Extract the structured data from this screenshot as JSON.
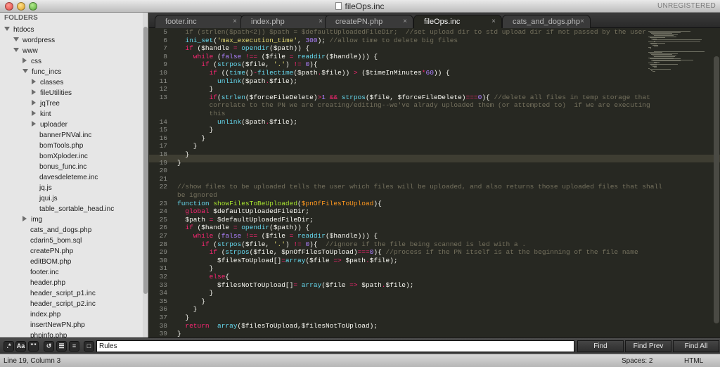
{
  "window": {
    "title": "fileOps.inc",
    "registration": "UNREGISTERED"
  },
  "sidebar": {
    "header": "FOLDERS",
    "items": [
      {
        "label": "htdocs",
        "depth": 0,
        "kind": "folder-open"
      },
      {
        "label": "wordpress",
        "depth": 1,
        "kind": "folder-open"
      },
      {
        "label": "www",
        "depth": 1,
        "kind": "folder-open"
      },
      {
        "label": "css",
        "depth": 2,
        "kind": "folder-closed"
      },
      {
        "label": "func_incs",
        "depth": 2,
        "kind": "folder-open"
      },
      {
        "label": "classes",
        "depth": 3,
        "kind": "folder-closed"
      },
      {
        "label": "fileUtilities",
        "depth": 3,
        "kind": "folder-closed"
      },
      {
        "label": "jqTree",
        "depth": 3,
        "kind": "folder-closed"
      },
      {
        "label": "kint",
        "depth": 3,
        "kind": "folder-closed"
      },
      {
        "label": "uploader",
        "depth": 3,
        "kind": "folder-closed"
      },
      {
        "label": "bannerPNVal.inc",
        "depth": 3,
        "kind": "file"
      },
      {
        "label": "bomTools.php",
        "depth": 3,
        "kind": "file"
      },
      {
        "label": "bomXploder.inc",
        "depth": 3,
        "kind": "file"
      },
      {
        "label": "bonus_func.inc",
        "depth": 3,
        "kind": "file"
      },
      {
        "label": "davesdeleteme.inc",
        "depth": 3,
        "kind": "file"
      },
      {
        "label": "jq.js",
        "depth": 3,
        "kind": "file"
      },
      {
        "label": "jqui.js",
        "depth": 3,
        "kind": "file"
      },
      {
        "label": "table_sortable_head.inc",
        "depth": 3,
        "kind": "file"
      },
      {
        "label": "img",
        "depth": 2,
        "kind": "folder-closed"
      },
      {
        "label": "cats_and_dogs.php",
        "depth": 2,
        "kind": "file"
      },
      {
        "label": "cdarin5_bom.sql",
        "depth": 2,
        "kind": "file"
      },
      {
        "label": "createPN.php",
        "depth": 2,
        "kind": "file"
      },
      {
        "label": "editBOM.php",
        "depth": 2,
        "kind": "file"
      },
      {
        "label": "footer.inc",
        "depth": 2,
        "kind": "file"
      },
      {
        "label": "header.php",
        "depth": 2,
        "kind": "file"
      },
      {
        "label": "header_script_p1.inc",
        "depth": 2,
        "kind": "file"
      },
      {
        "label": "header_script_p2.inc",
        "depth": 2,
        "kind": "file"
      },
      {
        "label": "index.php",
        "depth": 2,
        "kind": "file"
      },
      {
        "label": "insertNewPN.php",
        "depth": 2,
        "kind": "file"
      },
      {
        "label": "phpinfo.php",
        "depth": 2,
        "kind": "file"
      }
    ]
  },
  "tabs": [
    {
      "label": "footer.inc",
      "close": "×",
      "active": false
    },
    {
      "label": "index.php",
      "close": "×",
      "active": false
    },
    {
      "label": "createPN.php",
      "close": "×",
      "active": false
    },
    {
      "label": "fileOps.inc",
      "close": "×",
      "active": true
    },
    {
      "label": "cats_and_dogs.php",
      "close": "×",
      "active": false
    }
  ],
  "editor": {
    "line_numbers": [
      "5",
      "6",
      "7",
      "8",
      "9",
      "10",
      "11",
      "12",
      "13",
      "",
      "",
      "14",
      "15",
      "16",
      "17",
      "18",
      "19",
      "20",
      "21",
      "22",
      "",
      "23",
      "24",
      "25",
      "26",
      "27",
      "28",
      "29",
      "30",
      "31",
      "32",
      "33",
      "34",
      "35",
      "36",
      "37",
      "38",
      "39",
      "40"
    ],
    "code_lines": [
      {
        "indent": 2,
        "spans": [
          {
            "t": "if (strlen($path<2)) $path = $defaultUploadedFileDir;  //set upload dir to std upload dir if not passed by the user",
            "c": "c"
          }
        ]
      },
      {
        "indent": 2,
        "spans": [
          {
            "t": "ini_set",
            "c": "f"
          },
          {
            "t": "(",
            "c": ""
          },
          {
            "t": "'max_execution_time'",
            "c": "s"
          },
          {
            "t": ", ",
            "c": ""
          },
          {
            "t": "300",
            "c": "n"
          },
          {
            "t": "); ",
            "c": ""
          },
          {
            "t": "//allow time to delete big files",
            "c": "c"
          }
        ]
      },
      {
        "indent": 2,
        "spans": [
          {
            "t": "if",
            "c": "k"
          },
          {
            "t": " (",
            "c": ""
          },
          {
            "t": "$handle",
            "c": ""
          },
          {
            "t": " = ",
            "c": "k"
          },
          {
            "t": "opendir",
            "c": "f"
          },
          {
            "t": "(",
            "c": ""
          },
          {
            "t": "$path",
            "c": ""
          },
          {
            "t": ")) {",
            "c": ""
          }
        ]
      },
      {
        "indent": 4,
        "spans": [
          {
            "t": "while",
            "c": "k"
          },
          {
            "t": " (",
            "c": ""
          },
          {
            "t": "false",
            "c": "n"
          },
          {
            "t": " !== ",
            "c": "k"
          },
          {
            "t": "($file",
            "c": ""
          },
          {
            "t": " = ",
            "c": "k"
          },
          {
            "t": "readdir",
            "c": "f"
          },
          {
            "t": "($handle))) {",
            "c": ""
          }
        ]
      },
      {
        "indent": 6,
        "spans": [
          {
            "t": "if",
            "c": "k"
          },
          {
            "t": " (",
            "c": ""
          },
          {
            "t": "strpos",
            "c": "f"
          },
          {
            "t": "($file, ",
            "c": ""
          },
          {
            "t": "'.'",
            "c": "s"
          },
          {
            "t": ") ",
            "c": ""
          },
          {
            "t": "!=",
            "c": "k"
          },
          {
            "t": " ",
            "c": ""
          },
          {
            "t": "0",
            "c": "n"
          },
          {
            "t": "){",
            "c": ""
          }
        ]
      },
      {
        "indent": 8,
        "spans": [
          {
            "t": "if",
            "c": "k"
          },
          {
            "t": " ((",
            "c": ""
          },
          {
            "t": "time",
            "c": "f"
          },
          {
            "t": "()",
            "c": ""
          },
          {
            "t": "-",
            "c": "k"
          },
          {
            "t": "filectime",
            "c": "f"
          },
          {
            "t": "($path",
            "c": ""
          },
          {
            "t": ".",
            "c": "k"
          },
          {
            "t": "$file)) ",
            "c": ""
          },
          {
            "t": ">",
            "c": "k"
          },
          {
            "t": " ($timeInMinutes",
            "c": ""
          },
          {
            "t": "*",
            "c": "k"
          },
          {
            "t": "60",
            "c": "n"
          },
          {
            "t": ")) {",
            "c": ""
          }
        ]
      },
      {
        "indent": 10,
        "spans": [
          {
            "t": "unlink",
            "c": "f"
          },
          {
            "t": "($path",
            "c": ""
          },
          {
            "t": ".",
            "c": "k"
          },
          {
            "t": "$file);",
            "c": ""
          }
        ]
      },
      {
        "indent": 8,
        "spans": [
          {
            "t": "}",
            "c": ""
          }
        ]
      },
      {
        "indent": 8,
        "spans": [
          {
            "t": "if",
            "c": "k"
          },
          {
            "t": "(",
            "c": ""
          },
          {
            "t": "strlen",
            "c": "f"
          },
          {
            "t": "($forceFileDelete)",
            "c": ""
          },
          {
            "t": ">",
            "c": "k"
          },
          {
            "t": "1",
            "c": "n"
          },
          {
            "t": " && ",
            "c": "k"
          },
          {
            "t": "strpos",
            "c": "f"
          },
          {
            "t": "($file, $forceFileDelete)",
            "c": ""
          },
          {
            "t": "===",
            "c": "k"
          },
          {
            "t": "0",
            "c": "n"
          },
          {
            "t": "){ ",
            "c": ""
          },
          {
            "t": "//delete all files in temp storage that",
            "c": "c"
          }
        ]
      },
      {
        "indent": 8,
        "spans": [
          {
            "t": "correlate to the PN we are creating/editing--we've alrady uploaded them (or attempted to)  if we are executing",
            "c": "c"
          }
        ]
      },
      {
        "indent": 8,
        "spans": [
          {
            "t": "this",
            "c": "c"
          }
        ]
      },
      {
        "indent": 10,
        "spans": [
          {
            "t": "unlink",
            "c": "f"
          },
          {
            "t": "($path",
            "c": ""
          },
          {
            "t": ".",
            "c": "k"
          },
          {
            "t": "$file);",
            "c": ""
          }
        ]
      },
      {
        "indent": 8,
        "spans": [
          {
            "t": "}",
            "c": ""
          }
        ]
      },
      {
        "indent": 6,
        "spans": [
          {
            "t": "}",
            "c": ""
          }
        ]
      },
      {
        "indent": 4,
        "spans": [
          {
            "t": "}",
            "c": ""
          }
        ]
      },
      {
        "indent": 2,
        "spans": [
          {
            "t": "}",
            "c": ""
          }
        ]
      },
      {
        "indent": 0,
        "spans": [
          {
            "t": "}",
            "c": ""
          }
        ]
      },
      {
        "indent": 0,
        "spans": []
      },
      {
        "indent": 0,
        "spans": []
      },
      {
        "indent": 0,
        "spans": [
          {
            "t": "//show files to be uploaded tells the user which files will be uploaded, and also returns those uploaded files that shall",
            "c": "c"
          }
        ]
      },
      {
        "indent": 0,
        "spans": [
          {
            "t": "be ignored",
            "c": "c"
          }
        ]
      },
      {
        "indent": 0,
        "spans": [
          {
            "t": "function",
            "c": "f"
          },
          {
            "t": " ",
            "c": ""
          },
          {
            "t": "showFilesToBeUploaded",
            "c": "fn"
          },
          {
            "t": "(",
            "c": ""
          },
          {
            "t": "$pnOfFilesToUpload",
            "c": "v"
          },
          {
            "t": "){",
            "c": ""
          }
        ]
      },
      {
        "indent": 2,
        "spans": [
          {
            "t": "global",
            "c": "k"
          },
          {
            "t": " $defaultUploadedFileDir;",
            "c": ""
          }
        ]
      },
      {
        "indent": 2,
        "spans": [
          {
            "t": "$path",
            "c": ""
          },
          {
            "t": " = ",
            "c": "k"
          },
          {
            "t": "$defaultUploadedFileDir;",
            "c": ""
          }
        ]
      },
      {
        "indent": 2,
        "spans": [
          {
            "t": "if",
            "c": "k"
          },
          {
            "t": " (",
            "c": ""
          },
          {
            "t": "$handle",
            "c": ""
          },
          {
            "t": " = ",
            "c": "k"
          },
          {
            "t": "opendir",
            "c": "f"
          },
          {
            "t": "(",
            "c": ""
          },
          {
            "t": "$path",
            "c": ""
          },
          {
            "t": ")) {",
            "c": ""
          }
        ]
      },
      {
        "indent": 4,
        "spans": [
          {
            "t": "while",
            "c": "k"
          },
          {
            "t": " (",
            "c": ""
          },
          {
            "t": "false",
            "c": "n"
          },
          {
            "t": " !== ",
            "c": "k"
          },
          {
            "t": "($file",
            "c": ""
          },
          {
            "t": " = ",
            "c": "k"
          },
          {
            "t": "readdir",
            "c": "f"
          },
          {
            "t": "($handle))) {",
            "c": ""
          }
        ]
      },
      {
        "indent": 6,
        "spans": [
          {
            "t": "if",
            "c": "k"
          },
          {
            "t": " (",
            "c": ""
          },
          {
            "t": "strpos",
            "c": "f"
          },
          {
            "t": "($file, ",
            "c": ""
          },
          {
            "t": "'.'",
            "c": "s"
          },
          {
            "t": ") ",
            "c": ""
          },
          {
            "t": "!=",
            "c": "k"
          },
          {
            "t": " ",
            "c": ""
          },
          {
            "t": "0",
            "c": "n"
          },
          {
            "t": "){  ",
            "c": ""
          },
          {
            "t": "//ignore if the file being scanned is led with a .",
            "c": "c"
          }
        ]
      },
      {
        "indent": 8,
        "spans": [
          {
            "t": "if",
            "c": "k"
          },
          {
            "t": " (",
            "c": ""
          },
          {
            "t": "strpos",
            "c": "f"
          },
          {
            "t": "($file, $pnOfFilesToUpload)",
            "c": ""
          },
          {
            "t": "===",
            "c": "k"
          },
          {
            "t": "0",
            "c": "n"
          },
          {
            "t": "){ ",
            "c": ""
          },
          {
            "t": "//process if the PN itself is at the beginning of the file name",
            "c": "c"
          }
        ]
      },
      {
        "indent": 10,
        "spans": [
          {
            "t": "$filesToUpload[]",
            "c": ""
          },
          {
            "t": "=",
            "c": "k"
          },
          {
            "t": "array",
            "c": "f"
          },
          {
            "t": "($file ",
            "c": ""
          },
          {
            "t": "=>",
            "c": "k"
          },
          {
            "t": " $path",
            "c": ""
          },
          {
            "t": ".",
            "c": "k"
          },
          {
            "t": "$file);",
            "c": ""
          }
        ]
      },
      {
        "indent": 8,
        "spans": [
          {
            "t": "}",
            "c": ""
          }
        ]
      },
      {
        "indent": 8,
        "spans": [
          {
            "t": "else",
            "c": "k"
          },
          {
            "t": "{",
            "c": ""
          }
        ]
      },
      {
        "indent": 10,
        "spans": [
          {
            "t": "$filesNotToUpload[]",
            "c": ""
          },
          {
            "t": "= ",
            "c": "k"
          },
          {
            "t": "array",
            "c": "f"
          },
          {
            "t": "($file ",
            "c": ""
          },
          {
            "t": "=>",
            "c": "k"
          },
          {
            "t": " $path",
            "c": ""
          },
          {
            "t": ".",
            "c": "k"
          },
          {
            "t": "$file);",
            "c": ""
          }
        ]
      },
      {
        "indent": 8,
        "spans": [
          {
            "t": "}",
            "c": ""
          }
        ]
      },
      {
        "indent": 6,
        "spans": [
          {
            "t": "}",
            "c": ""
          }
        ]
      },
      {
        "indent": 4,
        "spans": [
          {
            "t": "}",
            "c": ""
          }
        ]
      },
      {
        "indent": 2,
        "spans": [
          {
            "t": "}",
            "c": ""
          }
        ]
      },
      {
        "indent": 2,
        "spans": [
          {
            "t": "return",
            "c": "k"
          },
          {
            "t": "  ",
            "c": ""
          },
          {
            "t": "array",
            "c": "f"
          },
          {
            "t": "($filesToUpload,$filesNotToUpload);",
            "c": ""
          }
        ]
      },
      {
        "indent": 0,
        "spans": [
          {
            "t": "}",
            "c": ""
          }
        ]
      },
      {
        "indent": 0,
        "spans": [
          {
            "t": "?>",
            "c": "k"
          }
        ]
      }
    ]
  },
  "findbar": {
    "toggles": [
      {
        "label": ".*",
        "name": "regex-toggle"
      },
      {
        "label": "Aa",
        "name": "case-sensitive-toggle"
      },
      {
        "label": "\"\"",
        "name": "whole-word-toggle"
      },
      {
        "label": "↺",
        "name": "wrap-toggle"
      },
      {
        "label": "☰",
        "name": "in-selection-toggle"
      },
      {
        "label": "≡",
        "name": "highlight-matches-toggle"
      },
      {
        "label": "□",
        "name": "preserve-case-toggle"
      }
    ],
    "query": "Rules",
    "find_label": "Find",
    "find_prev_label": "Find Prev",
    "find_all_label": "Find All"
  },
  "statusbar": {
    "position": "Line 19, Column 3",
    "spaces": "Spaces: 2",
    "syntax": "HTML"
  },
  "colors": {
    "editor_bg": "#272822",
    "keyword": "#f92672",
    "function": "#66d9ef",
    "string": "#e6db74",
    "comment": "#75715e",
    "number": "#ae81ff"
  }
}
